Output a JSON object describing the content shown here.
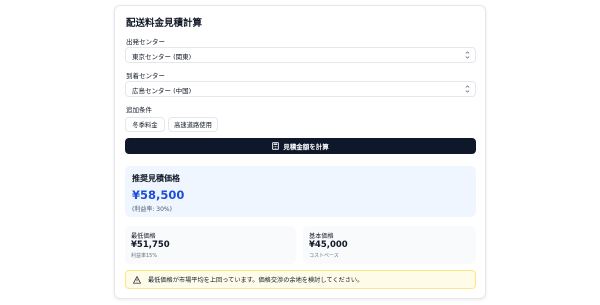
{
  "page": {
    "title": "配送料金見積計算"
  },
  "origin": {
    "label": "出発センター",
    "value": "東京センター (関東)"
  },
  "destination": {
    "label": "到着センター",
    "value": "広島センター (中国)"
  },
  "options": {
    "label": "追加条件",
    "chips": [
      "冬季料金",
      "高速道路使用"
    ]
  },
  "calculate": {
    "label": "見積金額を計算"
  },
  "result": {
    "recommended_title": "推奨見積価格",
    "recommended_price": "¥58,500",
    "recommended_margin": "(利益率: 30%)",
    "min_label": "最低価格",
    "min_price": "¥51,750",
    "min_note": "利益率15%",
    "base_label": "基本価格",
    "base_price": "¥45,000",
    "base_note": "コストベース"
  },
  "warning": {
    "text": "最低価格が市場平均を上回っています。価格交渉の余地を検討してください。",
    "icon": "warning-icon"
  },
  "colors": {
    "accent": "#1d4ed8",
    "button_bg": "#0f172a",
    "recommend_bg": "#eff6ff",
    "warning_bg": "#fefce8"
  }
}
